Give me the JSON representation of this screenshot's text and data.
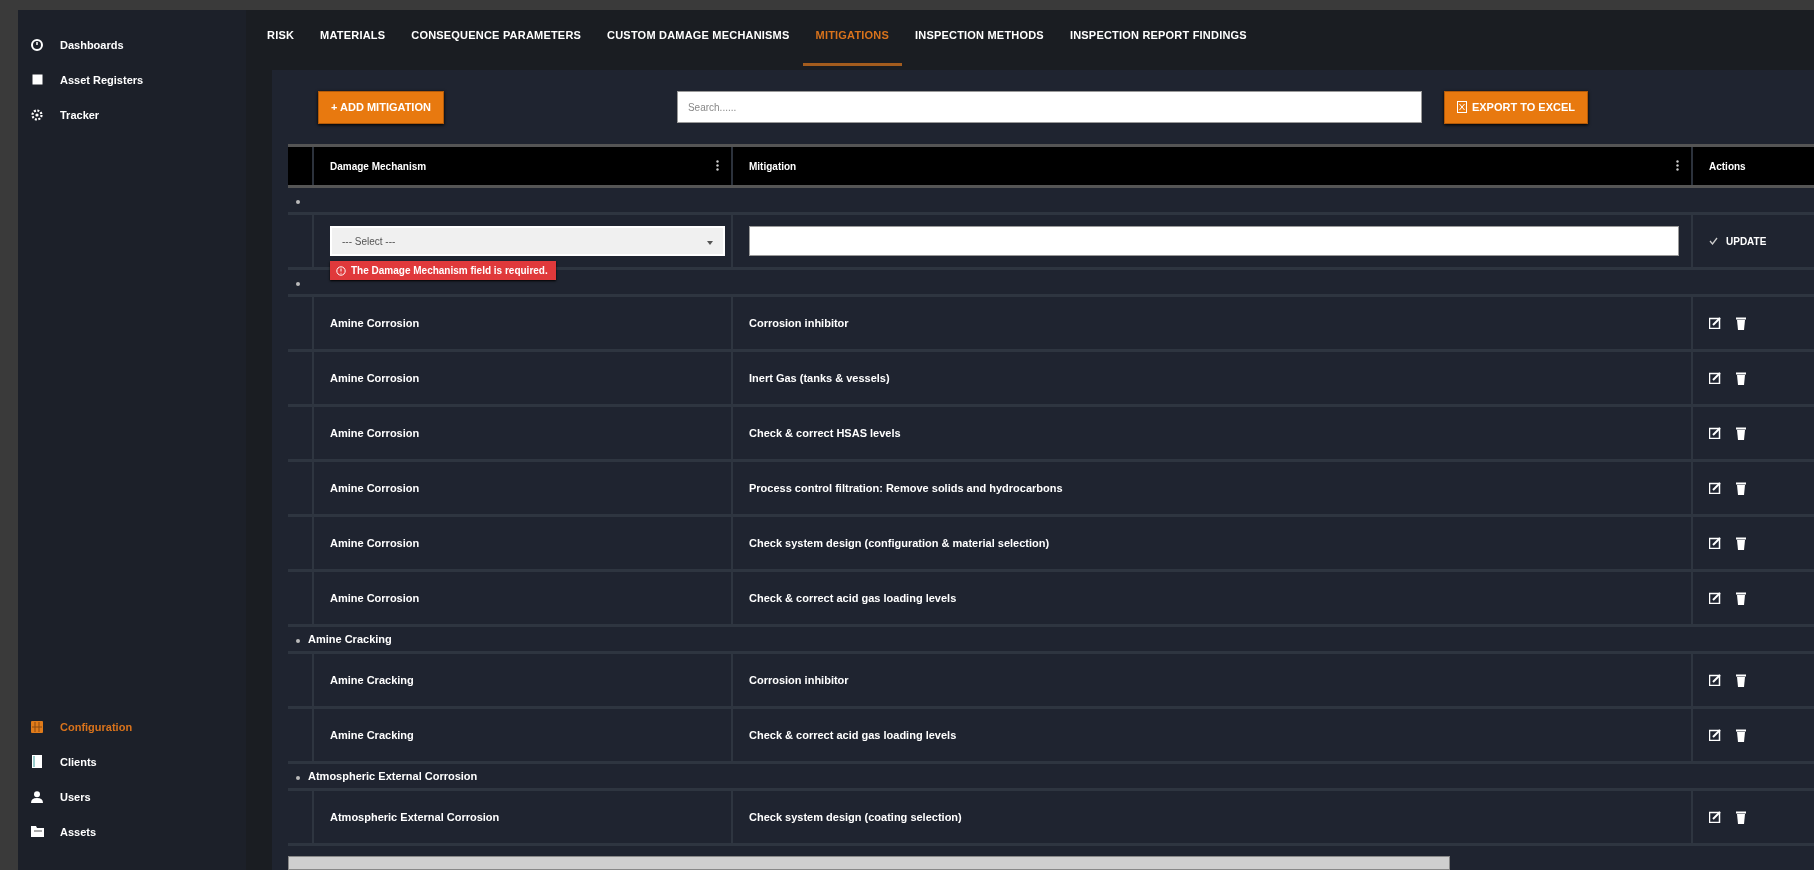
{
  "sidebar": {
    "top_items": [
      {
        "label": "Dashboards",
        "selected": false
      },
      {
        "label": "Asset Registers",
        "selected": false
      },
      {
        "label": "Tracker",
        "selected": false
      }
    ],
    "bottom_items": [
      {
        "label": "Configuration",
        "selected": true
      },
      {
        "label": "Clients",
        "selected": false
      },
      {
        "label": "Users",
        "selected": false
      },
      {
        "label": "Assets",
        "selected": false
      }
    ]
  },
  "tabs": [
    {
      "label": "RISK",
      "selected": false
    },
    {
      "label": "MATERIALS",
      "selected": false
    },
    {
      "label": "CONSEQUENCE PARAMETERS",
      "selected": false
    },
    {
      "label": "CUSTOM DAMAGE MECHANISMS",
      "selected": false
    },
    {
      "label": "MITIGATIONS",
      "selected": true
    },
    {
      "label": "INSPECTION METHODS",
      "selected": false
    },
    {
      "label": "INSPECTION REPORT FINDINGS",
      "selected": false
    }
  ],
  "toolbar": {
    "add_button": "+ ADD MITIGATION",
    "search": {
      "placeholder": "Search......"
    },
    "export_button": "EXPORT TO EXCEL"
  },
  "table": {
    "columns": [
      "Damage Mechanism",
      "Mitigation",
      "Actions"
    ],
    "edit_row": {
      "select_placeholder": "--- Select ---",
      "error": "The Damage Mechanism field is required.",
      "update_button": "UPDATE"
    },
    "groups": [
      {
        "rows": [
          [
            "Amine Corrosion",
            "Corrosion inhibitor"
          ],
          [
            "Amine Corrosion",
            "Inert Gas (tanks & vessels)"
          ],
          [
            "Amine Corrosion",
            "Check & correct HSAS levels"
          ],
          [
            "Amine Corrosion",
            "Process control filtration: Remove solids and hydrocarbons"
          ],
          [
            "Amine Corrosion",
            "Check system design (configuration & material selection)"
          ],
          [
            "Amine Corrosion",
            "Check & correct acid gas loading levels"
          ]
        ]
      },
      {
        "label": "Amine Cracking",
        "rows": [
          [
            "Amine Cracking",
            "Corrosion inhibitor"
          ],
          [
            "Amine Cracking",
            "Check & correct acid gas loading levels"
          ]
        ]
      },
      {
        "label": "Atmospheric External Corrosion",
        "rows": [
          [
            "Atmospheric External Corrosion",
            "Check system design (coating selection)"
          ]
        ]
      }
    ]
  }
}
